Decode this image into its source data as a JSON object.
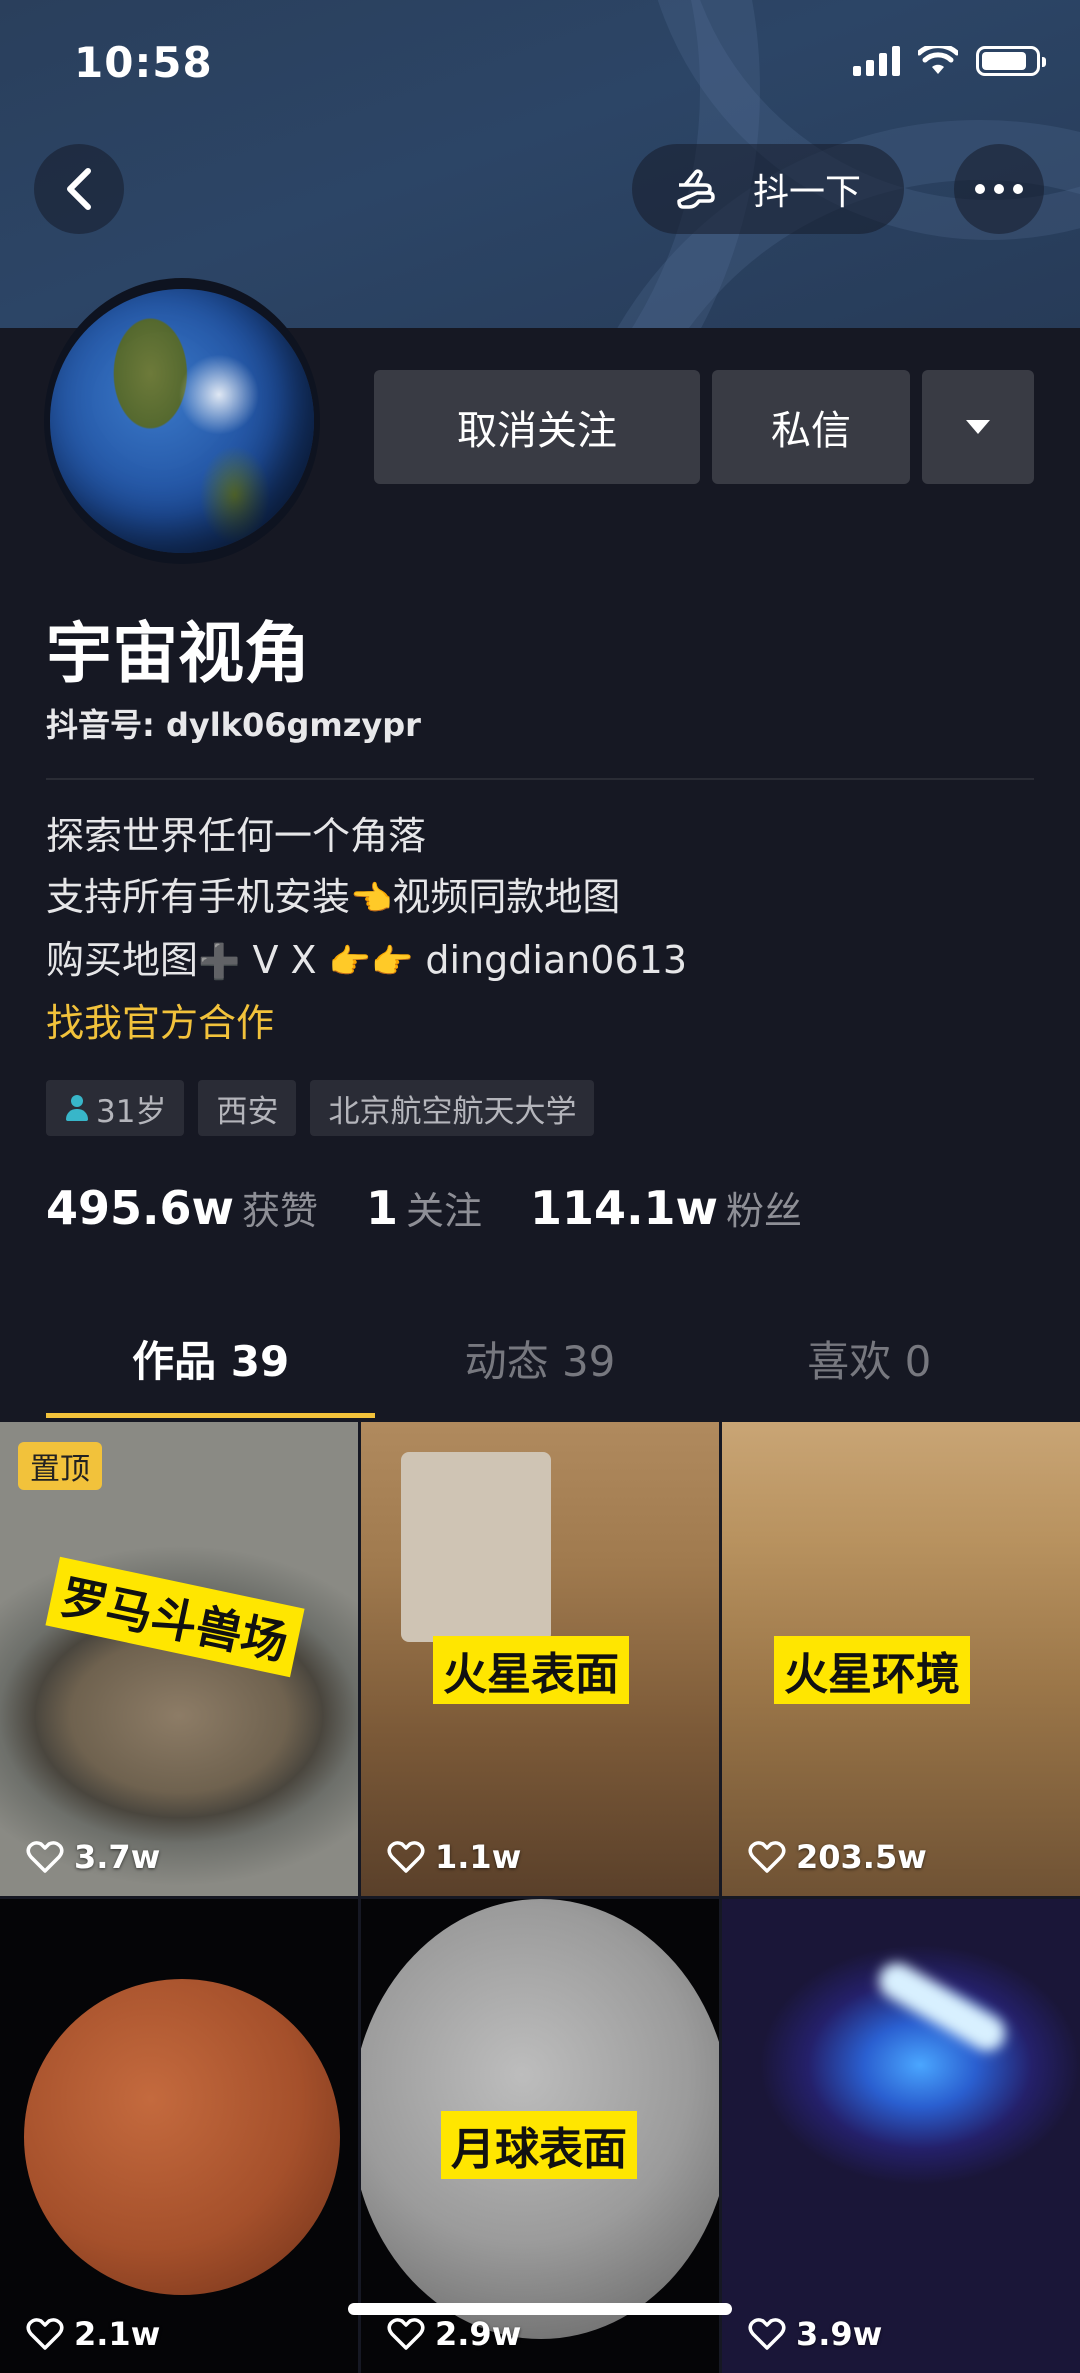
{
  "status_bar": {
    "time": "10:58"
  },
  "header": {
    "shake_label": "抖一下"
  },
  "actions": {
    "unfollow": "取消关注",
    "message": "私信"
  },
  "profile": {
    "name": "宇宙视角",
    "douyin_id": "抖音号: dylk06gmzypr",
    "bio": {
      "line1": "探索世界任何一个角落",
      "line2_text": "支持所有手机安装",
      "line2_emoji": "👈",
      "line2_after": "视频同款地图",
      "line3_text": "购买地图",
      "line3_plus": "➕",
      "line3_vx": " V X ",
      "line3_emoji": "👉👉",
      "line3_after": " dingdian0613",
      "link": "找我官方合作"
    },
    "tags": [
      "31岁",
      "西安",
      "北京航空航天大学"
    ],
    "stats": [
      {
        "num": "495.6w",
        "label": "获赞"
      },
      {
        "num": "1",
        "label": "关注"
      },
      {
        "num": "114.1w",
        "label": "粉丝"
      }
    ]
  },
  "tabs": [
    {
      "label": "作品 39",
      "active": true
    },
    {
      "label": "动态 39",
      "active": false
    },
    {
      "label": "喜欢 0",
      "active": false
    }
  ],
  "videos": [
    {
      "caption": "罗马斗兽场",
      "likes": "3.7w",
      "pinned_label": "置顶"
    },
    {
      "caption": "火星表面",
      "likes": "1.1w"
    },
    {
      "caption": "火星环境",
      "likes": "203.5w"
    },
    {
      "caption": "",
      "likes": "2.1w"
    },
    {
      "caption": "月球表面",
      "likes": "2.9w"
    },
    {
      "caption": "",
      "likes": "3.9w"
    }
  ],
  "colors": {
    "accent": "#f2c23b",
    "background": "#161823",
    "button": "#393b44"
  }
}
